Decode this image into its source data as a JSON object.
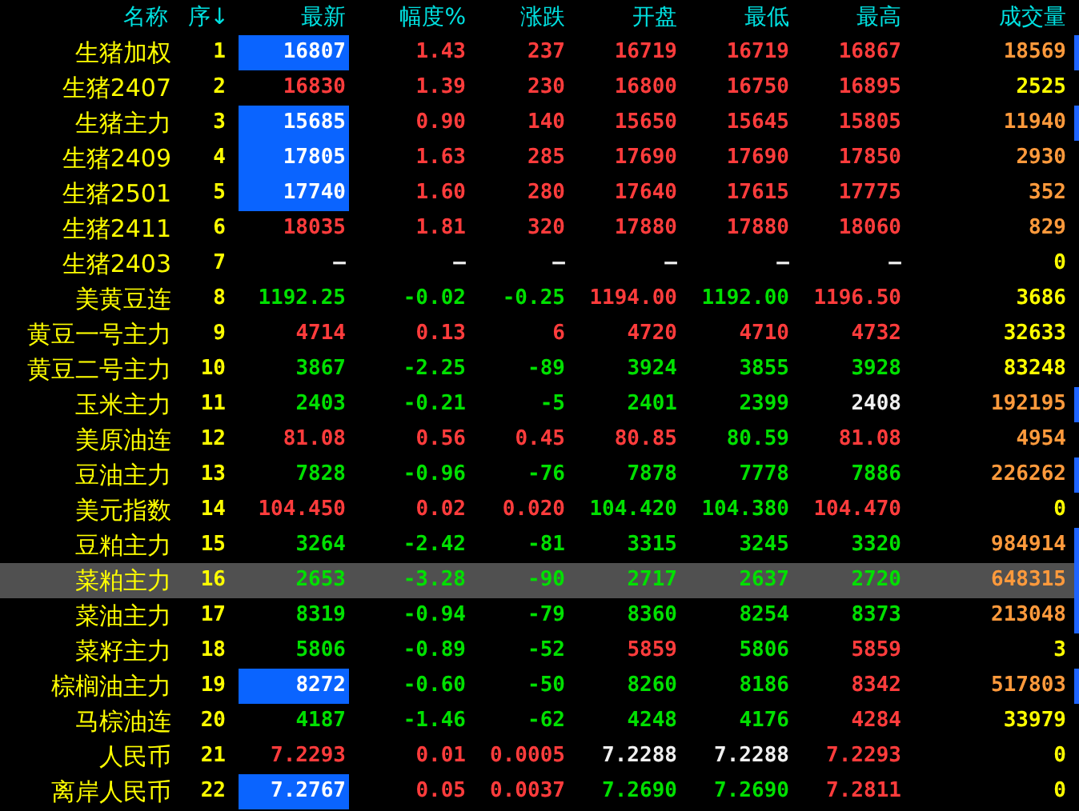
{
  "columns": [
    "名称",
    "序↓",
    "最新",
    "幅度%",
    "涨跌",
    "开盘",
    "最低",
    "最高",
    "成交量"
  ],
  "rows": [
    {
      "name": "生猪加权",
      "seq": "1",
      "selected": false,
      "marker": true,
      "latest": {
        "text": "16807",
        "boxed": true
      },
      "cells": [
        {
          "text": "1.43",
          "up": true,
          "down": false
        },
        {
          "text": "237",
          "up": true,
          "down": false
        },
        {
          "text": "16719",
          "up": true,
          "down": false
        },
        {
          "text": "16719",
          "up": true,
          "down": false
        },
        {
          "text": "16867",
          "up": true,
          "down": false
        }
      ],
      "volume": {
        "text": "18569",
        "highlight": true
      }
    },
    {
      "name": "生猪2407",
      "seq": "2",
      "selected": false,
      "marker": false,
      "latest": {
        "text": "16830",
        "up": true,
        "down": false,
        "boxed": false
      },
      "cells": [
        {
          "text": "1.39",
          "up": true,
          "down": false
        },
        {
          "text": "230",
          "up": true,
          "down": false
        },
        {
          "text": "16800",
          "up": true,
          "down": false
        },
        {
          "text": "16750",
          "up": true,
          "down": false
        },
        {
          "text": "16895",
          "up": true,
          "down": false
        }
      ],
      "volume": {
        "text": "2525",
        "highlight": false
      }
    },
    {
      "name": "生猪主力",
      "seq": "3",
      "selected": false,
      "marker": true,
      "latest": {
        "text": "15685",
        "boxed": true
      },
      "cells": [
        {
          "text": "0.90",
          "up": true,
          "down": false
        },
        {
          "text": "140",
          "up": true,
          "down": false
        },
        {
          "text": "15650",
          "up": true,
          "down": false
        },
        {
          "text": "15645",
          "up": true,
          "down": false
        },
        {
          "text": "15805",
          "up": true,
          "down": false
        }
      ],
      "volume": {
        "text": "11940",
        "highlight": true
      }
    },
    {
      "name": "生猪2409",
      "seq": "4",
      "selected": false,
      "marker": false,
      "latest": {
        "text": "17805",
        "boxed": true
      },
      "cells": [
        {
          "text": "1.63",
          "up": true,
          "down": false
        },
        {
          "text": "285",
          "up": true,
          "down": false
        },
        {
          "text": "17690",
          "up": true,
          "down": false
        },
        {
          "text": "17690",
          "up": true,
          "down": false
        },
        {
          "text": "17850",
          "up": true,
          "down": false
        }
      ],
      "volume": {
        "text": "2930",
        "highlight": true
      }
    },
    {
      "name": "生猪2501",
      "seq": "5",
      "selected": false,
      "marker": false,
      "latest": {
        "text": "17740",
        "boxed": true
      },
      "cells": [
        {
          "text": "1.60",
          "up": true,
          "down": false
        },
        {
          "text": "280",
          "up": true,
          "down": false
        },
        {
          "text": "17640",
          "up": true,
          "down": false
        },
        {
          "text": "17615",
          "up": true,
          "down": false
        },
        {
          "text": "17775",
          "up": true,
          "down": false
        }
      ],
      "volume": {
        "text": "352",
        "highlight": true
      }
    },
    {
      "name": "生猪2411",
      "seq": "6",
      "selected": false,
      "marker": false,
      "latest": {
        "text": "18035",
        "up": true,
        "down": false,
        "boxed": false
      },
      "cells": [
        {
          "text": "1.81",
          "up": true,
          "down": false
        },
        {
          "text": "320",
          "up": true,
          "down": false
        },
        {
          "text": "17880",
          "up": true,
          "down": false
        },
        {
          "text": "17880",
          "up": true,
          "down": false
        },
        {
          "text": "18060",
          "up": true,
          "down": false
        }
      ],
      "volume": {
        "text": "829",
        "highlight": true
      }
    },
    {
      "name": "生猪2403",
      "seq": "7",
      "selected": false,
      "marker": false,
      "latest": {
        "text": "—",
        "up": false,
        "down": false,
        "boxed": false
      },
      "cells": [
        {
          "text": "—",
          "up": false,
          "down": false
        },
        {
          "text": "—",
          "up": false,
          "down": false
        },
        {
          "text": "—",
          "up": false,
          "down": false
        },
        {
          "text": "—",
          "up": false,
          "down": false
        },
        {
          "text": "—",
          "up": false,
          "down": false
        }
      ],
      "volume": {
        "text": "0",
        "highlight": false
      }
    },
    {
      "name": "美黄豆连",
      "seq": "8",
      "selected": false,
      "marker": false,
      "latest": {
        "text": "1192.25",
        "up": false,
        "down": true,
        "boxed": false
      },
      "cells": [
        {
          "text": "-0.02",
          "up": false,
          "down": true
        },
        {
          "text": "-0.25",
          "up": false,
          "down": true
        },
        {
          "text": "1194.00",
          "up": true,
          "down": false
        },
        {
          "text": "1192.00",
          "up": false,
          "down": true
        },
        {
          "text": "1196.50",
          "up": true,
          "down": false
        }
      ],
      "volume": {
        "text": "3686",
        "highlight": false
      }
    },
    {
      "name": "黄豆一号主力",
      "seq": "9",
      "selected": false,
      "marker": false,
      "latest": {
        "text": "4714",
        "up": true,
        "down": false,
        "boxed": false
      },
      "cells": [
        {
          "text": "0.13",
          "up": true,
          "down": false
        },
        {
          "text": "6",
          "up": true,
          "down": false
        },
        {
          "text": "4720",
          "up": true,
          "down": false
        },
        {
          "text": "4710",
          "up": true,
          "down": false
        },
        {
          "text": "4732",
          "up": true,
          "down": false
        }
      ],
      "volume": {
        "text": "32633",
        "highlight": false
      }
    },
    {
      "name": "黄豆二号主力",
      "seq": "10",
      "selected": false,
      "marker": false,
      "latest": {
        "text": "3867",
        "up": false,
        "down": true,
        "boxed": false
      },
      "cells": [
        {
          "text": "-2.25",
          "up": false,
          "down": true
        },
        {
          "text": "-89",
          "up": false,
          "down": true
        },
        {
          "text": "3924",
          "up": false,
          "down": true
        },
        {
          "text": "3855",
          "up": false,
          "down": true
        },
        {
          "text": "3928",
          "up": false,
          "down": true
        }
      ],
      "volume": {
        "text": "83248",
        "highlight": false
      }
    },
    {
      "name": "玉米主力",
      "seq": "11",
      "selected": false,
      "marker": true,
      "latest": {
        "text": "2403",
        "up": false,
        "down": true,
        "boxed": false
      },
      "cells": [
        {
          "text": "-0.21",
          "up": false,
          "down": true
        },
        {
          "text": "-5",
          "up": false,
          "down": true
        },
        {
          "text": "2401",
          "up": false,
          "down": true
        },
        {
          "text": "2399",
          "up": false,
          "down": true
        },
        {
          "text": "2408",
          "up": false,
          "down": false
        }
      ],
      "volume": {
        "text": "192195",
        "highlight": true
      }
    },
    {
      "name": "美原油连",
      "seq": "12",
      "selected": false,
      "marker": false,
      "latest": {
        "text": "81.08",
        "up": true,
        "down": false,
        "boxed": false
      },
      "cells": [
        {
          "text": "0.56",
          "up": true,
          "down": false
        },
        {
          "text": "0.45",
          "up": true,
          "down": false
        },
        {
          "text": "80.85",
          "up": true,
          "down": false
        },
        {
          "text": "80.59",
          "up": false,
          "down": true
        },
        {
          "text": "81.08",
          "up": true,
          "down": false
        }
      ],
      "volume": {
        "text": "4954",
        "highlight": true
      }
    },
    {
      "name": "豆油主力",
      "seq": "13",
      "selected": false,
      "marker": true,
      "latest": {
        "text": "7828",
        "up": false,
        "down": true,
        "boxed": false
      },
      "cells": [
        {
          "text": "-0.96",
          "up": false,
          "down": true
        },
        {
          "text": "-76",
          "up": false,
          "down": true
        },
        {
          "text": "7878",
          "up": false,
          "down": true
        },
        {
          "text": "7778",
          "up": false,
          "down": true
        },
        {
          "text": "7886",
          "up": false,
          "down": true
        }
      ],
      "volume": {
        "text": "226262",
        "highlight": true
      }
    },
    {
      "name": "美元指数",
      "seq": "14",
      "selected": false,
      "marker": false,
      "latest": {
        "text": "104.450",
        "up": true,
        "down": false,
        "boxed": false
      },
      "cells": [
        {
          "text": "0.02",
          "up": true,
          "down": false
        },
        {
          "text": "0.020",
          "up": true,
          "down": false
        },
        {
          "text": "104.420",
          "up": false,
          "down": true
        },
        {
          "text": "104.380",
          "up": false,
          "down": true
        },
        {
          "text": "104.470",
          "up": true,
          "down": false
        }
      ],
      "volume": {
        "text": "0",
        "highlight": false
      }
    },
    {
      "name": "豆粕主力",
      "seq": "15",
      "selected": false,
      "marker": true,
      "latest": {
        "text": "3264",
        "up": false,
        "down": true,
        "boxed": false
      },
      "cells": [
        {
          "text": "-2.42",
          "up": false,
          "down": true
        },
        {
          "text": "-81",
          "up": false,
          "down": true
        },
        {
          "text": "3315",
          "up": false,
          "down": true
        },
        {
          "text": "3245",
          "up": false,
          "down": true
        },
        {
          "text": "3320",
          "up": false,
          "down": true
        }
      ],
      "volume": {
        "text": "984914",
        "highlight": true
      }
    },
    {
      "name": "菜粕主力",
      "seq": "16",
      "selected": true,
      "marker": true,
      "latest": {
        "text": "2653",
        "up": false,
        "down": true,
        "boxed": false
      },
      "cells": [
        {
          "text": "-3.28",
          "up": false,
          "down": true
        },
        {
          "text": "-90",
          "up": false,
          "down": true
        },
        {
          "text": "2717",
          "up": false,
          "down": true
        },
        {
          "text": "2637",
          "up": false,
          "down": true
        },
        {
          "text": "2720",
          "up": false,
          "down": true
        }
      ],
      "volume": {
        "text": "648315",
        "highlight": true
      }
    },
    {
      "name": "菜油主力",
      "seq": "17",
      "selected": false,
      "marker": true,
      "latest": {
        "text": "8319",
        "up": false,
        "down": true,
        "boxed": false
      },
      "cells": [
        {
          "text": "-0.94",
          "up": false,
          "down": true
        },
        {
          "text": "-79",
          "up": false,
          "down": true
        },
        {
          "text": "8360",
          "up": false,
          "down": true
        },
        {
          "text": "8254",
          "up": false,
          "down": true
        },
        {
          "text": "8373",
          "up": false,
          "down": true
        }
      ],
      "volume": {
        "text": "213048",
        "highlight": true
      }
    },
    {
      "name": "菜籽主力",
      "seq": "18",
      "selected": false,
      "marker": false,
      "latest": {
        "text": "5806",
        "up": false,
        "down": true,
        "boxed": false
      },
      "cells": [
        {
          "text": "-0.89",
          "up": false,
          "down": true
        },
        {
          "text": "-52",
          "up": false,
          "down": true
        },
        {
          "text": "5859",
          "up": true,
          "down": false
        },
        {
          "text": "5806",
          "up": false,
          "down": true
        },
        {
          "text": "5859",
          "up": true,
          "down": false
        }
      ],
      "volume": {
        "text": "3",
        "highlight": false
      }
    },
    {
      "name": "棕榈油主力",
      "seq": "19",
      "selected": false,
      "marker": true,
      "latest": {
        "text": "8272",
        "boxed": true
      },
      "cells": [
        {
          "text": "-0.60",
          "up": false,
          "down": true
        },
        {
          "text": "-50",
          "up": false,
          "down": true
        },
        {
          "text": "8260",
          "up": false,
          "down": true
        },
        {
          "text": "8186",
          "up": false,
          "down": true
        },
        {
          "text": "8342",
          "up": true,
          "down": false
        }
      ],
      "volume": {
        "text": "517803",
        "highlight": true
      }
    },
    {
      "name": "马棕油连",
      "seq": "20",
      "selected": false,
      "marker": false,
      "latest": {
        "text": "4187",
        "up": false,
        "down": true,
        "boxed": false
      },
      "cells": [
        {
          "text": "-1.46",
          "up": false,
          "down": true
        },
        {
          "text": "-62",
          "up": false,
          "down": true
        },
        {
          "text": "4248",
          "up": false,
          "down": true
        },
        {
          "text": "4176",
          "up": false,
          "down": true
        },
        {
          "text": "4284",
          "up": true,
          "down": false
        }
      ],
      "volume": {
        "text": "33979",
        "highlight": false
      }
    },
    {
      "name": "人民币",
      "seq": "21",
      "selected": false,
      "marker": false,
      "latest": {
        "text": "7.2293",
        "up": true,
        "down": false,
        "boxed": false
      },
      "cells": [
        {
          "text": "0.01",
          "up": true,
          "down": false
        },
        {
          "text": "0.0005",
          "up": true,
          "down": false
        },
        {
          "text": "7.2288",
          "up": false,
          "down": false
        },
        {
          "text": "7.2288",
          "up": false,
          "down": false
        },
        {
          "text": "7.2293",
          "up": true,
          "down": false
        }
      ],
      "volume": {
        "text": "0",
        "highlight": false
      }
    },
    {
      "name": "离岸人民币",
      "seq": "22",
      "selected": false,
      "marker": false,
      "latest": {
        "text": "7.2767",
        "boxed": true
      },
      "cells": [
        {
          "text": "0.05",
          "up": true,
          "down": false
        },
        {
          "text": "0.0037",
          "up": true,
          "down": false
        },
        {
          "text": "7.2690",
          "up": false,
          "down": true
        },
        {
          "text": "7.2690",
          "up": false,
          "down": true
        },
        {
          "text": "7.2811",
          "up": true,
          "down": false
        }
      ],
      "volume": {
        "text": "0",
        "highlight": false
      }
    }
  ]
}
